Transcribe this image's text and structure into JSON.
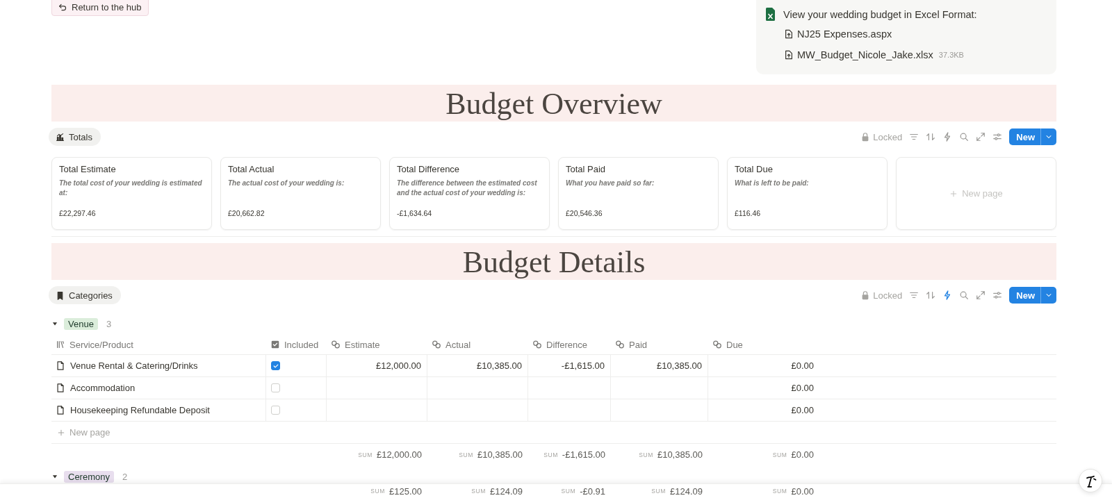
{
  "back_button": {
    "label": "Return to the hub"
  },
  "attachments": {
    "heading": "View your wedding budget in Excel Format:",
    "files": [
      {
        "name": "NJ25 Expenses.aspx"
      },
      {
        "name": "MW_Budget_Nicole_Jake.xlsx",
        "size": "37.3KB"
      }
    ]
  },
  "overview": {
    "title": "Budget Overview",
    "view": {
      "label": "Totals",
      "kind": "chart"
    },
    "toolbar": {
      "locked": "Locked",
      "automations_on": false,
      "new_button": "New"
    },
    "cards": [
      {
        "title": "Total Estimate",
        "description": "The total cost of your wedding is estimated at:",
        "value": "£22,297.46"
      },
      {
        "title": "Total Actual",
        "description": "The actual cost of your wedding is:",
        "value": "£20,662.82"
      },
      {
        "title": "Total Difference",
        "description": "The difference between the estimated cost and the actual cost of your wedding is:",
        "value": "-£1,634.64"
      },
      {
        "title": "Total Paid",
        "description": "What you have paid so far:",
        "value": "£20,546.36"
      },
      {
        "title": "Total Due",
        "description": "What is left to be paid:",
        "value": "£116.46"
      }
    ],
    "new_card": "New page"
  },
  "details": {
    "title": "Budget Details",
    "view": {
      "label": "Categories",
      "kind": "bookmark"
    },
    "toolbar": {
      "locked": "Locked",
      "automations_on": true,
      "new_button": "New"
    },
    "columns": [
      {
        "label": "Service/Product",
        "kind": "title"
      },
      {
        "label": "Included",
        "kind": "checkbox"
      },
      {
        "label": "Estimate",
        "kind": "formula"
      },
      {
        "label": "Actual",
        "kind": "formula"
      },
      {
        "label": "Difference",
        "kind": "formula"
      },
      {
        "label": "Paid",
        "kind": "formula"
      },
      {
        "label": "Due",
        "kind": "formula"
      }
    ],
    "groups": [
      {
        "tag": "Venue",
        "color": "#dbeddb",
        "count": "3",
        "expanded": true,
        "rows": [
          {
            "name": "Venue Rental & Catering/Drinks",
            "included": true,
            "estimate": "£12,000.00",
            "actual": "£10,385.00",
            "difference": "-£1,615.00",
            "paid": "£10,385.00",
            "due": "£0.00"
          },
          {
            "name": "Accommodation",
            "included": false,
            "due": "£0.00"
          },
          {
            "name": "Housekeeping Refundable Deposit",
            "included": false,
            "due": "£0.00"
          }
        ],
        "new_row": "New page",
        "sums": [
          {
            "label": "SUM",
            "value": "£12,000.00"
          },
          {
            "label": "SUM",
            "value": "£10,385.00"
          },
          {
            "label": "SUM",
            "value": "-£1,615.00"
          },
          {
            "label": "SUM",
            "value": "£10,385.00"
          },
          {
            "label": "SUM",
            "value": "£0.00"
          }
        ]
      },
      {
        "tag": "Ceremony",
        "color": "#e8deee",
        "count": "2",
        "expanded": true,
        "sums": [
          {
            "label": "SUM",
            "value": "£125.00"
          },
          {
            "label": "SUM",
            "value": "£124.09"
          },
          {
            "label": "SUM",
            "value": "-£0.91"
          },
          {
            "label": "SUM",
            "value": "£124.09"
          },
          {
            "label": "SUM",
            "value": "£0.00"
          }
        ]
      }
    ]
  }
}
